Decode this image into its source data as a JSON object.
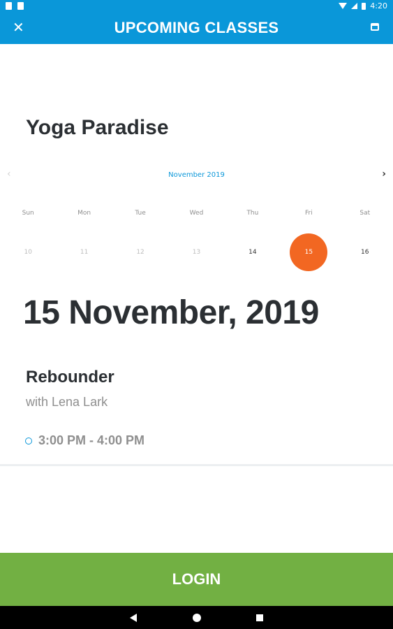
{
  "status_bar": {
    "time": "4:20"
  },
  "toolbar": {
    "title": "UPCOMING CLASSES",
    "close_glyph": "✕"
  },
  "studio": {
    "name": "Yoga Paradise"
  },
  "calendar": {
    "month_label": "November 2019",
    "prev_glyph": "‹",
    "next_glyph": "›",
    "weekdays": [
      "Sun",
      "Mon",
      "Tue",
      "Wed",
      "Thu",
      "Fri",
      "Sat"
    ],
    "days": [
      "10",
      "11",
      "12",
      "13",
      "14",
      "15",
      "16"
    ],
    "selected_day": "15",
    "selected_color": "#f26722"
  },
  "selected_date": "15 November, 2019",
  "class": {
    "name": "Rebounder",
    "instructor": "with Lena Lark",
    "time": "3:00 PM - 4:00 PM"
  },
  "login": {
    "label": "LOGIN"
  },
  "colors": {
    "primary": "#0a97d9",
    "login": "#72b043",
    "accent": "#f26722"
  },
  "icons": [
    "close-icon",
    "calendar-icon",
    "clock-icon",
    "chevron-left-icon",
    "chevron-right-icon"
  ]
}
